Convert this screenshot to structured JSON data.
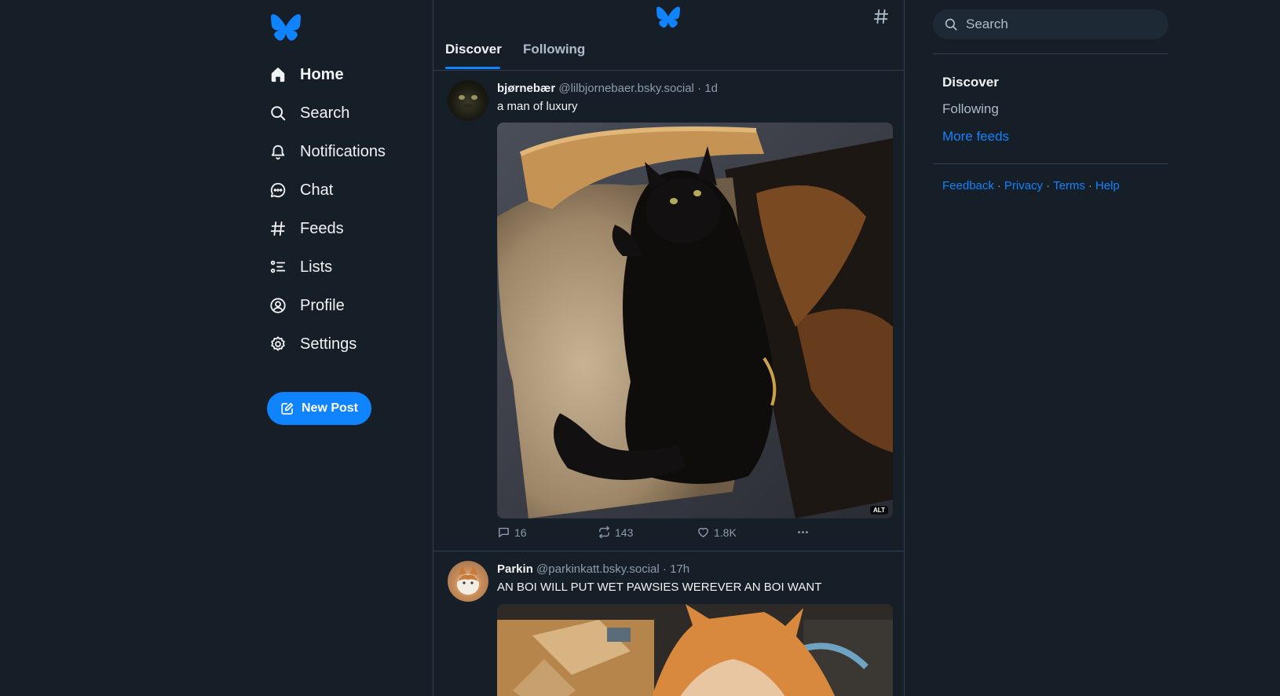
{
  "nav": {
    "items": [
      {
        "label": "Home",
        "icon": "home-icon"
      },
      {
        "label": "Search",
        "icon": "search-icon"
      },
      {
        "label": "Notifications",
        "icon": "bell-icon"
      },
      {
        "label": "Chat",
        "icon": "chat-icon"
      },
      {
        "label": "Feeds",
        "icon": "hash-icon"
      },
      {
        "label": "Lists",
        "icon": "list-icon"
      },
      {
        "label": "Profile",
        "icon": "profile-icon"
      },
      {
        "label": "Settings",
        "icon": "gear-icon"
      }
    ],
    "new_post_label": "New Post"
  },
  "feed": {
    "tabs": [
      "Discover",
      "Following"
    ],
    "posts": [
      {
        "display_name": "bjørnebær",
        "handle": "@lilbjornebaer.bsky.social",
        "time": "1d",
        "text": "a man of luxury",
        "alt_badge": "ALT",
        "replies": "16",
        "reposts": "143",
        "likes": "1.8K"
      },
      {
        "display_name": "Parkin",
        "handle": "@parkinkatt.bsky.social",
        "time": "17h",
        "text": "AN BOI WILL PUT WET PAWSIES WEREVER AN BOI WANT"
      }
    ]
  },
  "right": {
    "search_placeholder": "Search",
    "feeds": [
      "Discover",
      "Following"
    ],
    "more_feeds": "More feeds",
    "footer": [
      "Feedback",
      "Privacy",
      "Terms",
      "Help"
    ]
  },
  "colors": {
    "background": "#161e27",
    "accent": "#1083fe",
    "border": "#2e4052",
    "muted_text": "#8d9cad"
  }
}
